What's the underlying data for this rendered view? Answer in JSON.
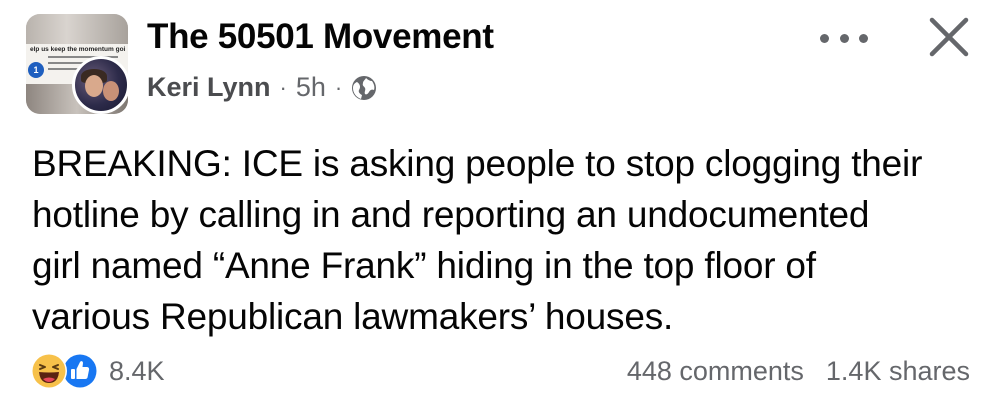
{
  "header": {
    "group_name": "The 50501 Movement",
    "author": "Keri Lynn",
    "separator": "·",
    "time": "5h",
    "audience_icon": "globe-icon",
    "group_thumb_text": "elp us keep the momentum goi",
    "group_thumb_badge": "1",
    "more_icon": "more-horizontal-icon",
    "close_icon": "close-icon"
  },
  "post": {
    "lines": [
      "BREAKING: ICE is asking people to stop clogging their",
      "hotline by calling in and reporting an undocumented",
      "girl named “Anne Frank” hiding in the top floor of",
      "various Republican lawmakers’ houses."
    ]
  },
  "footer": {
    "reaction_icons": [
      "haha-reaction-icon",
      "like-reaction-icon"
    ],
    "reaction_count": "8.4K",
    "comments": "448 comments",
    "shares": "1.4K shares"
  },
  "colors": {
    "text": "#050505",
    "secondary": "#65676b",
    "like_blue": "#1877f2",
    "haha_yellow": "#f7c14a"
  }
}
